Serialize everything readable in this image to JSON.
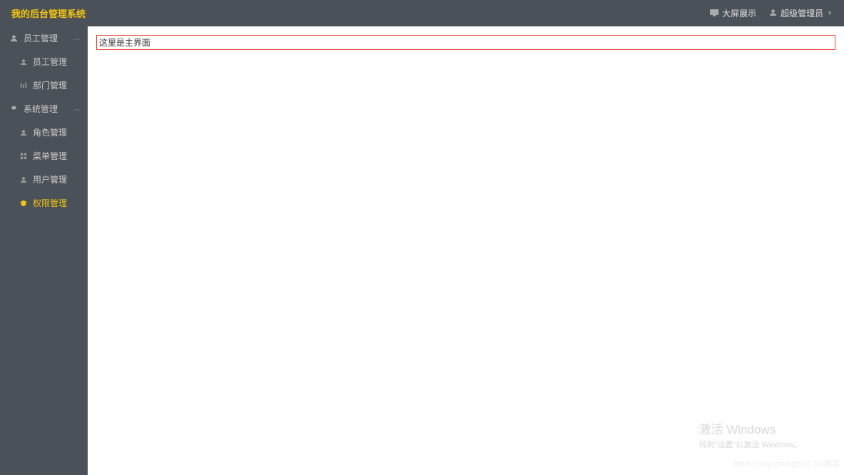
{
  "header": {
    "title": "我的后台管理系统",
    "bigscreen_label": "大屏展示",
    "user_label": "超级管理员"
  },
  "sidebar": {
    "groups": [
      {
        "label": "员工管理",
        "items": [
          {
            "label": "员工管理",
            "icon": "person"
          },
          {
            "label": "部门管理",
            "icon": "bars"
          }
        ]
      },
      {
        "label": "系统管理",
        "items": [
          {
            "label": "角色管理",
            "icon": "person"
          },
          {
            "label": "菜单管理",
            "icon": "grid"
          },
          {
            "label": "用户管理",
            "icon": "person"
          },
          {
            "label": "权限管理",
            "icon": "shield",
            "active": true
          }
        ]
      }
    ]
  },
  "content": {
    "main_text": "这里是主界面"
  },
  "watermark": {
    "title": "激活 Windows",
    "subtitle": "转到\"设置\"以激活 Windows。"
  },
  "blog_watermark": "https://blog.csdn@51CTO博客"
}
